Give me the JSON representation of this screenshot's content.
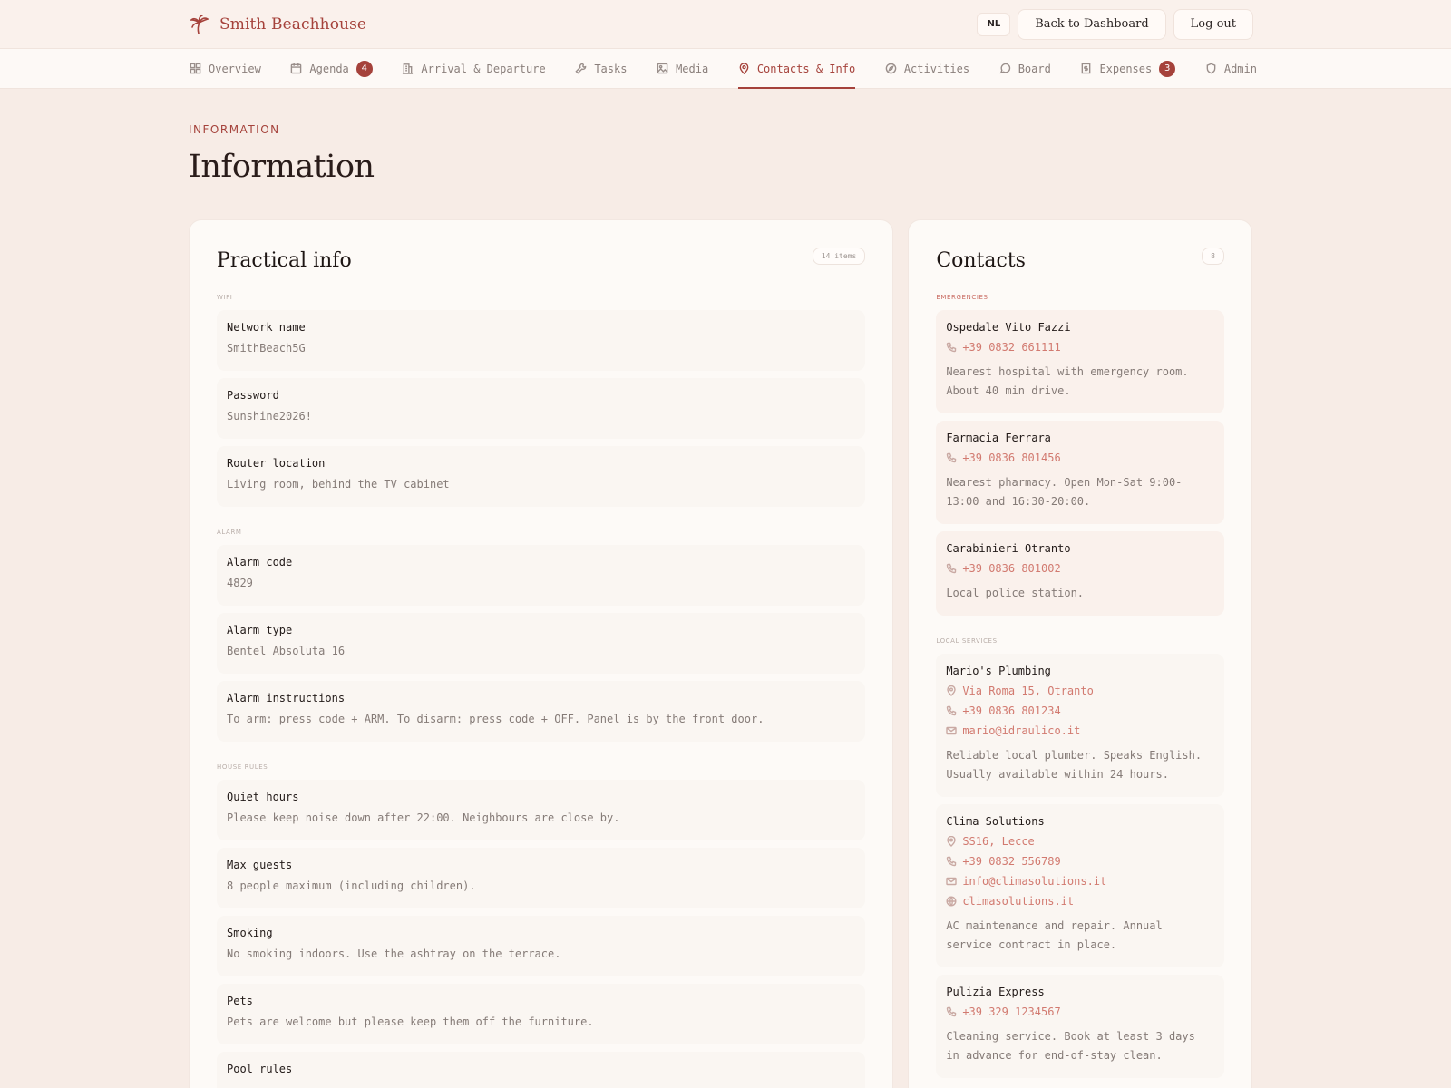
{
  "brand": {
    "name": "Smith Beachhouse",
    "logo_icon": "palm-icon"
  },
  "header": {
    "lang": "NL",
    "back_label": "Back to Dashboard",
    "logout_label": "Log out"
  },
  "nav": [
    {
      "label": "Overview",
      "icon": "grid-icon"
    },
    {
      "label": "Agenda",
      "icon": "calendar-icon",
      "badge": "4"
    },
    {
      "label": "Arrival & Departure",
      "icon": "building-icon"
    },
    {
      "label": "Tasks",
      "icon": "wrench-icon"
    },
    {
      "label": "Media",
      "icon": "image-icon"
    },
    {
      "label": "Contacts & Info",
      "icon": "pin-icon",
      "active": true
    },
    {
      "label": "Activities",
      "icon": "compass-icon"
    },
    {
      "label": "Board",
      "icon": "chat-icon"
    },
    {
      "label": "Expenses",
      "icon": "receipt-icon",
      "badge": "3"
    },
    {
      "label": "Admin",
      "icon": "shield-icon"
    }
  ],
  "page": {
    "eyebrow": "INFORMATION",
    "title": "Information"
  },
  "practical": {
    "title": "Practical info",
    "count": "14 items",
    "sections": [
      {
        "label": "WIFI",
        "items": [
          {
            "label": "Network name",
            "value": "SmithBeach5G"
          },
          {
            "label": "Password",
            "value": "Sunshine2026!"
          },
          {
            "label": "Router location",
            "value": "Living room, behind the TV cabinet"
          }
        ]
      },
      {
        "label": "ALARM",
        "items": [
          {
            "label": "Alarm code",
            "value": "4829"
          },
          {
            "label": "Alarm type",
            "value": "Bentel Absoluta 16"
          },
          {
            "label": "Alarm instructions",
            "value": "To arm: press code + ARM. To disarm: press code + OFF. Panel is by the front door."
          }
        ]
      },
      {
        "label": "HOUSE RULES",
        "items": [
          {
            "label": "Quiet hours",
            "value": "Please keep noise down after 22:00. Neighbours are close by."
          },
          {
            "label": "Max guests",
            "value": "8 people maximum (including children)."
          },
          {
            "label": "Smoking",
            "value": "No smoking indoors. Use the ashtray on the terrace."
          },
          {
            "label": "Pets",
            "value": "Pets are welcome but please keep them off the furniture."
          },
          {
            "label": "Pool rules",
            "value": ""
          }
        ]
      }
    ]
  },
  "contacts": {
    "title": "Contacts",
    "count": "8",
    "emergencies_label": "EMERGENCIES",
    "emergencies": [
      {
        "name": "Ospedale Vito Fazzi",
        "phone": "+39 0832 661111",
        "desc": "Nearest hospital with emergency room. About 40 min drive."
      },
      {
        "name": "Farmacia Ferrara",
        "phone": "+39 0836 801456",
        "desc": "Nearest pharmacy. Open Mon-Sat 9:00-13:00 and 16:30-20:00."
      },
      {
        "name": "Carabinieri Otranto",
        "phone": "+39 0836 801002",
        "desc": "Local police station."
      }
    ],
    "local_label": "LOCAL SERVICES",
    "local": [
      {
        "name": "Mario's Plumbing",
        "address": "Via Roma 15, Otranto",
        "phone": "+39 0836 801234",
        "email": "mario@idraulico.it",
        "website": "",
        "desc": "Reliable local plumber. Speaks English. Usually available within 24 hours."
      },
      {
        "name": "Clima Solutions",
        "address": "SS16, Lecce",
        "phone": "+39 0832 556789",
        "email": "info@climasolutions.it",
        "website": "climasolutions.it",
        "desc": "AC maintenance and repair. Annual service contract in place."
      },
      {
        "name": "Pulizia Express",
        "address": "",
        "phone": "+39 329 1234567",
        "email": "",
        "website": "",
        "desc": "Cleaning service. Book at least 3 days in advance for end-of-stay clean."
      }
    ]
  }
}
